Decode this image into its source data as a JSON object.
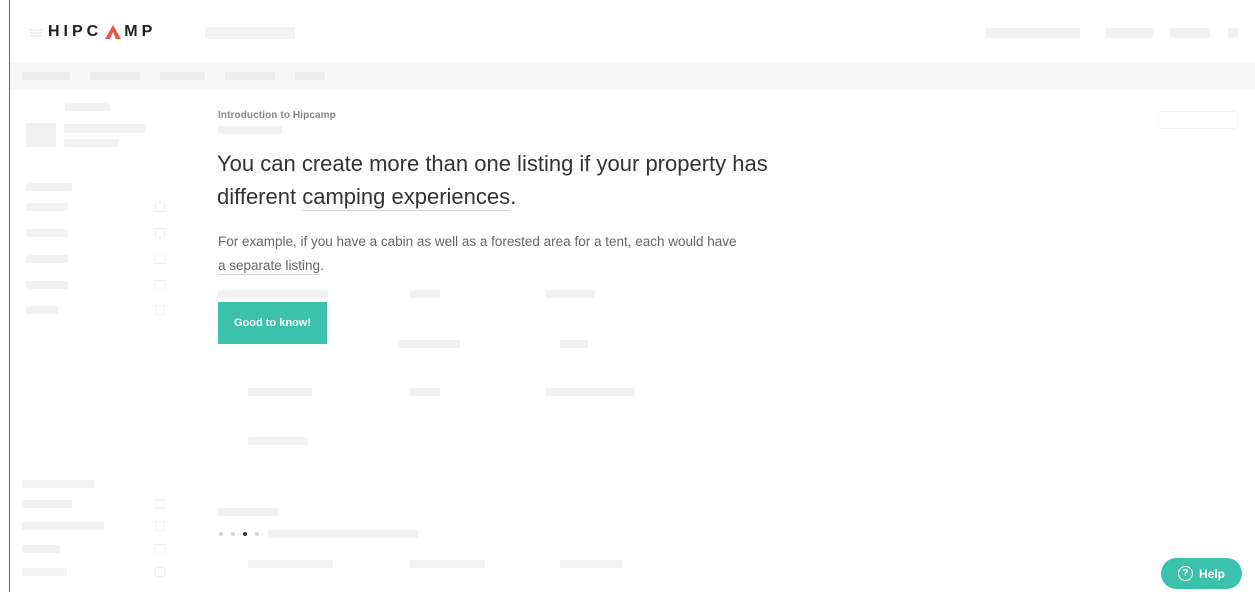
{
  "brand": {
    "logo_left": "HIPC",
    "logo_right": "MP",
    "accent_color": "#3cc2ac"
  },
  "modal": {
    "intro_label": "Introduction to Hipcamp",
    "headline_line1": "You can create more than one listing if your property has",
    "headline_line2_pre": "different ",
    "headline_line2_link": "camping experiences",
    "headline_line2_post": ".",
    "body_line1": "For example, if you have a cabin as well as a forested area for a tent, each would have",
    "body_line2_link": "a separate listing",
    "body_line2_post": ".",
    "cta_label": "Good to know!"
  },
  "pagination": {
    "total": 4,
    "active_index": 2
  },
  "help": {
    "label": "Help",
    "icon_glyph": "?",
    "icon": "question-circle-icon"
  }
}
